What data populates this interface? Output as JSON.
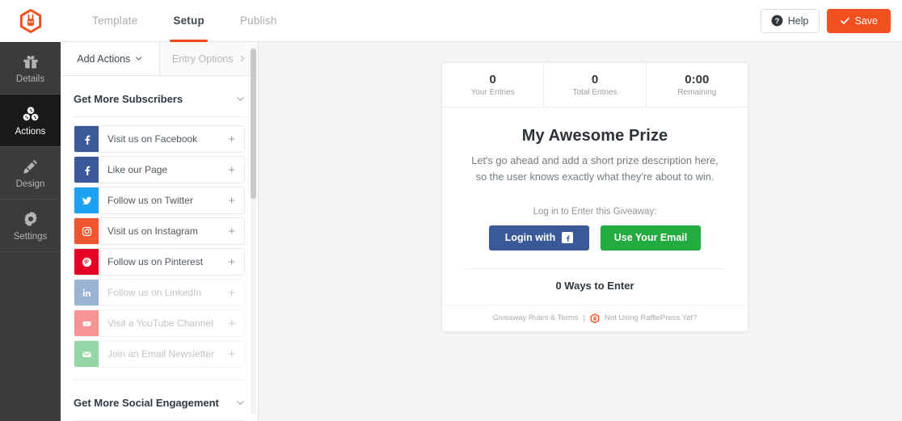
{
  "topbar": {
    "logo_icon": "rafflepress-logo-icon",
    "tabs": [
      {
        "label": "Template",
        "active": false
      },
      {
        "label": "Setup",
        "active": true
      },
      {
        "label": "Publish",
        "active": false
      }
    ],
    "help_label": "Help",
    "help_icon": "question-circle-icon",
    "save_label": "Save",
    "save_icon": "check-icon",
    "accent_color": "#f2501e"
  },
  "rail": {
    "items": [
      {
        "label": "Details",
        "icon": "gift-icon",
        "active": false
      },
      {
        "label": "Actions",
        "icon": "blocks-icon",
        "active": true
      },
      {
        "label": "Design",
        "icon": "pencil-ruler-icon",
        "active": false
      },
      {
        "label": "Settings",
        "icon": "gear-icon",
        "active": false
      }
    ]
  },
  "panel": {
    "tabs": [
      {
        "label": "Add Actions",
        "icon": "chevron-down-icon",
        "active": true
      },
      {
        "label": "Entry Options",
        "icon": "chevron-right-icon",
        "active": false
      }
    ],
    "sections": [
      {
        "title": "Get More Subscribers",
        "icon": "chevron-down-icon",
        "expanded": true
      },
      {
        "title": "Get More Social Engagement",
        "icon": "chevron-down-icon",
        "expanded": false
      }
    ],
    "actions": [
      {
        "label": "Visit us on Facebook",
        "icon": "facebook-icon",
        "color": "#3b5998",
        "add_icon": "plus-icon",
        "dim": false
      },
      {
        "label": "Like our Page",
        "icon": "facebook-icon",
        "color": "#3b5998",
        "add_icon": "plus-icon",
        "dim": false
      },
      {
        "label": "Follow us on Twitter",
        "icon": "twitter-icon",
        "color": "#1da1f2",
        "add_icon": "plus-icon",
        "dim": false
      },
      {
        "label": "Visit us on Instagram",
        "icon": "instagram-icon",
        "color": "#f0552f",
        "add_icon": "plus-icon",
        "dim": false
      },
      {
        "label": "Follow us on Pinterest",
        "icon": "pinterest-icon",
        "color": "#e60023",
        "add_icon": "plus-icon",
        "dim": false
      },
      {
        "label": "Follow us on LinkedIn",
        "icon": "linkedin-icon",
        "color": "#4a77b4",
        "add_icon": "plus-icon",
        "dim": true
      },
      {
        "label": "Visit a YouTube Channel",
        "icon": "youtube-icon",
        "color": "#ef3b3b",
        "add_icon": "plus-icon",
        "dim": true
      },
      {
        "label": "Join an Email Newsletter",
        "icon": "envelope-icon",
        "color": "#3fb55e",
        "add_icon": "plus-icon",
        "dim": true
      }
    ]
  },
  "preview": {
    "stats": [
      {
        "value": "0",
        "label": "Your Entries"
      },
      {
        "value": "0",
        "label": "Total Entries"
      },
      {
        "value": "0:00",
        "label": "Remaining"
      }
    ],
    "prize_title": "My Awesome Prize",
    "prize_description": "Let's go ahead and add a short prize description here, so the user knows exactly what they're about to win.",
    "login_prompt": "Log in to Enter this Giveaway:",
    "facebook_button": {
      "label": "Login with",
      "icon": "facebook-icon",
      "color": "#3b5998"
    },
    "email_button": {
      "label": "Use Your Email",
      "color": "#22ab3f"
    },
    "ways_to_enter": "0 Ways to Enter",
    "footer": {
      "rules_link": "Giveaway Rules & Terms",
      "divider": "|",
      "brand_icon": "rafflepress-logo-icon",
      "promo_link": "Not Using RafflePress Yet?"
    }
  }
}
